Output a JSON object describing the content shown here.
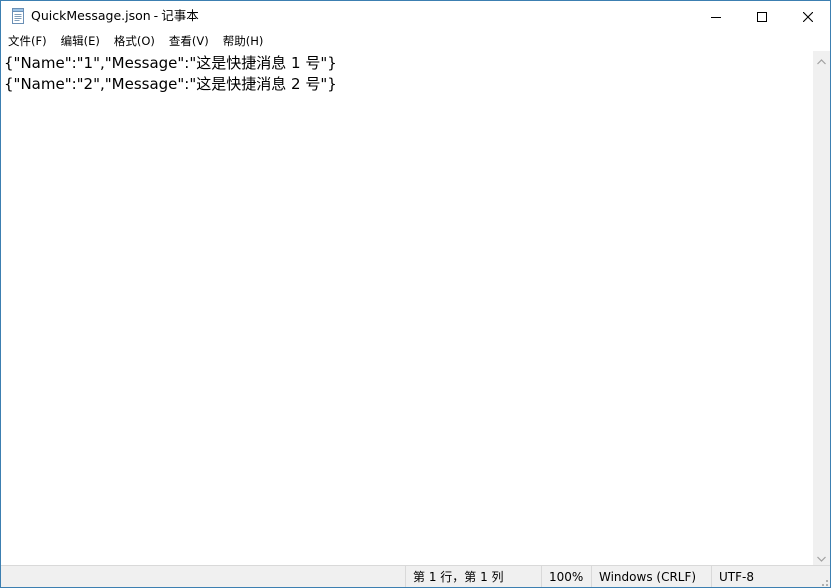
{
  "window": {
    "file_name": "QuickMessage.json",
    "separator": "-",
    "app_name": "记事本",
    "icon": "notepad-icon"
  },
  "caption_buttons": {
    "minimize_icon": "minimize-icon",
    "maximize_icon": "maximize-icon",
    "close_icon": "close-icon"
  },
  "menu": {
    "items": [
      {
        "label": "文件(F)"
      },
      {
        "label": "编辑(E)"
      },
      {
        "label": "格式(O)"
      },
      {
        "label": "查看(V)"
      },
      {
        "label": "帮助(H)"
      }
    ]
  },
  "editor": {
    "lines": [
      "{\"Name\":\"1\",\"Message\":\"这是快捷消息 1 号\"}",
      "{\"Name\":\"2\",\"Message\":\"这是快捷消息 2 号\"}"
    ]
  },
  "status": {
    "position": "第 1 行，第 1 列",
    "zoom": "100%",
    "line_ending": "Windows (CRLF)",
    "encoding": "UTF-8"
  },
  "colors": {
    "window_border": "#3c7fb1",
    "statusbar_bg": "#f0f0f0",
    "scrollbar_bg": "#f0f0f0"
  }
}
